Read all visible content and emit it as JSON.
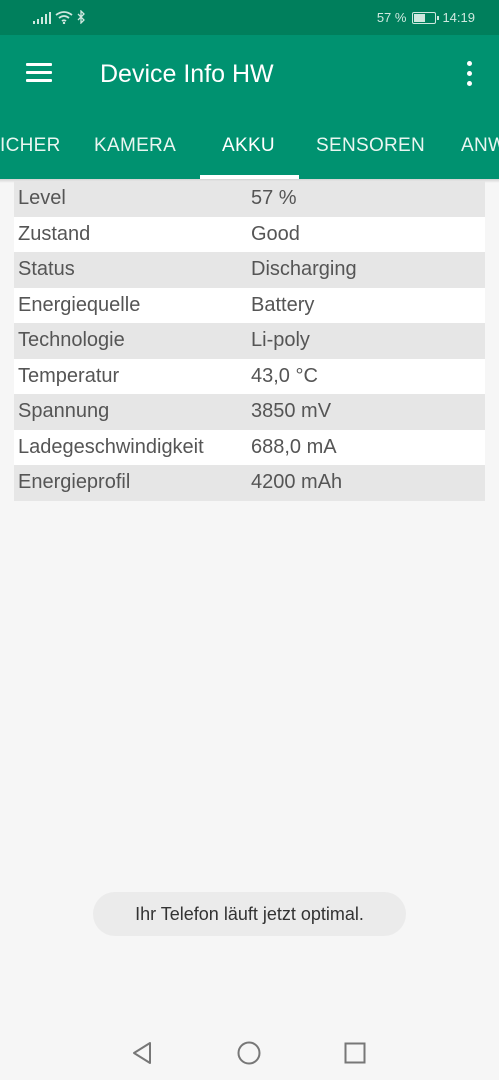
{
  "status_bar": {
    "battery_percent": "57 %",
    "battery_level": 0.57,
    "time": "14:19"
  },
  "app_bar": {
    "title": "Device Info HW"
  },
  "tabs": [
    {
      "label": "ICHER"
    },
    {
      "label": "KAMERA"
    },
    {
      "label": "AKKU",
      "active": true
    },
    {
      "label": "SENSOREN"
    },
    {
      "label": "ANW"
    }
  ],
  "battery_info": {
    "rows": [
      {
        "label": "Level",
        "value": "57 %"
      },
      {
        "label": "Zustand",
        "value": "Good"
      },
      {
        "label": "Status",
        "value": "Discharging"
      },
      {
        "label": "Energiequelle",
        "value": "Battery"
      },
      {
        "label": "Technologie",
        "value": "Li-poly"
      },
      {
        "label": "Temperatur",
        "value": "43,0 °C"
      },
      {
        "label": "Spannung",
        "value": "3850 mV"
      },
      {
        "label": "Ladegeschwindigkeit",
        "value": "688,0 mA"
      },
      {
        "label": "Energieprofil",
        "value": "4200 mAh"
      }
    ]
  },
  "toast": {
    "message": "Ihr Telefon läuft jetzt optimal."
  },
  "colors": {
    "primary": "#009270",
    "status_bar": "#007f5c"
  },
  "icons": {
    "menu": "menu-icon",
    "more": "more-vert-icon",
    "back": "back-triangle-icon",
    "home": "home-circle-icon",
    "recents": "recents-square-icon"
  }
}
